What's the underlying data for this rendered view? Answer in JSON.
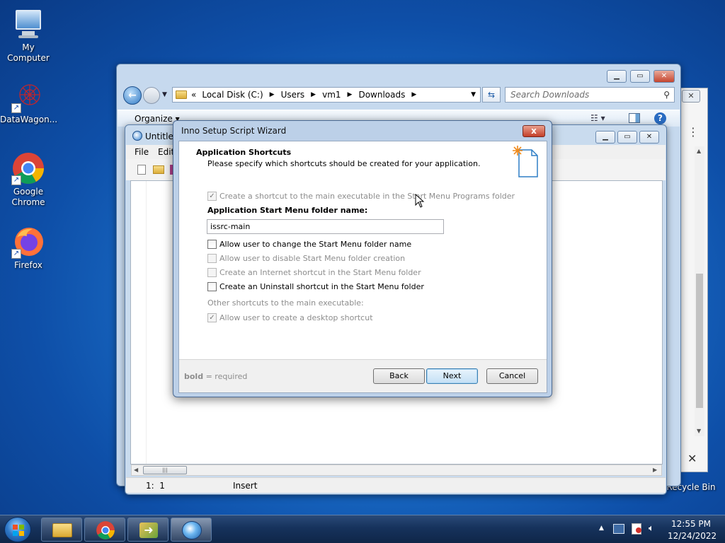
{
  "desktop": {
    "icons": [
      {
        "label": "My Computer"
      },
      {
        "label": "DataWagon..."
      },
      {
        "label": "Google Chrome"
      },
      {
        "label": "Firefox"
      },
      {
        "label": "Recycle Bin"
      }
    ]
  },
  "explorer": {
    "address": {
      "overflow": "«",
      "crumbs": [
        "Local Disk (C:)",
        "Users",
        "vm1",
        "Downloads"
      ]
    },
    "search_placeholder": "Search Downloads",
    "toolbar": {
      "organize": "Organize ▾"
    }
  },
  "editor": {
    "title": "Untitled",
    "menu": {
      "file": "File",
      "edit": "Edit"
    },
    "status": {
      "position": "1:  1",
      "mode": "Insert"
    }
  },
  "wizard": {
    "title": "Inno Setup Script Wizard",
    "close": "x",
    "heading": "Application Shortcuts",
    "subheading": "Please specify which shortcuts should be created for your application.",
    "options": {
      "create_shortcut": "Create a shortcut to the main executable in the Start Menu Programs folder",
      "folder_label": "Application Start Menu folder name:",
      "folder_value": "issrc-main",
      "allow_change": "Allow user to change the Start Menu folder name",
      "allow_disable": "Allow user to disable Start Menu folder creation",
      "internet_shortcut": "Create an Internet shortcut in the Start Menu folder",
      "uninstall_shortcut": "Create an Uninstall shortcut in the Start Menu folder",
      "other_label": "Other shortcuts to the main executable:",
      "desktop_shortcut": "Allow user to create a desktop shortcut"
    },
    "footer": {
      "bold": "bold",
      "required": " = required"
    },
    "buttons": {
      "back": "Back",
      "next": "Next",
      "cancel": "Cancel"
    }
  },
  "taskbar": {
    "clock": {
      "time": "12:55 PM",
      "date": "12/24/2022"
    }
  }
}
